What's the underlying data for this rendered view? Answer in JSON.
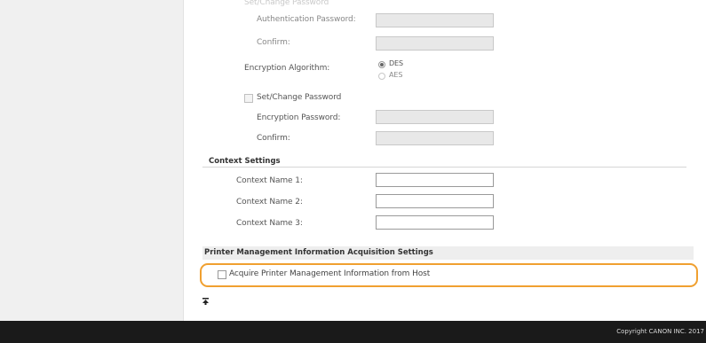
{
  "snmpv3": {
    "header_partial": "Set/Change Password",
    "auth_password_label": "Authentication Password:",
    "auth_confirm_label": "Confirm:",
    "encryption_algorithm_label": "Encryption Algorithm:",
    "des_label": "DES",
    "aes_label": "AES",
    "set_change_password_label": "Set/Change Password",
    "encryption_password_label": "Encryption Password:",
    "encryption_confirm_label": "Confirm:"
  },
  "context_settings": {
    "heading": "Context Settings",
    "name1_label": "Context Name 1:",
    "name2_label": "Context Name 2:",
    "name3_label": "Context Name 3:",
    "name1_value": "",
    "name2_value": "",
    "name3_value": ""
  },
  "printer_mgmt": {
    "heading": "Printer Management Information Acquisition Settings",
    "acquire_label": "Acquire Printer Management Information from Host",
    "acquire_checked": false
  },
  "top_icon": "to-top-icon",
  "footer": {
    "copyright": "Copyright CANON INC. 2017"
  },
  "colors": {
    "highlight": "#f0a030",
    "footer_bg": "#1a1a1a",
    "left_pane_bg": "#f0f0f0"
  }
}
